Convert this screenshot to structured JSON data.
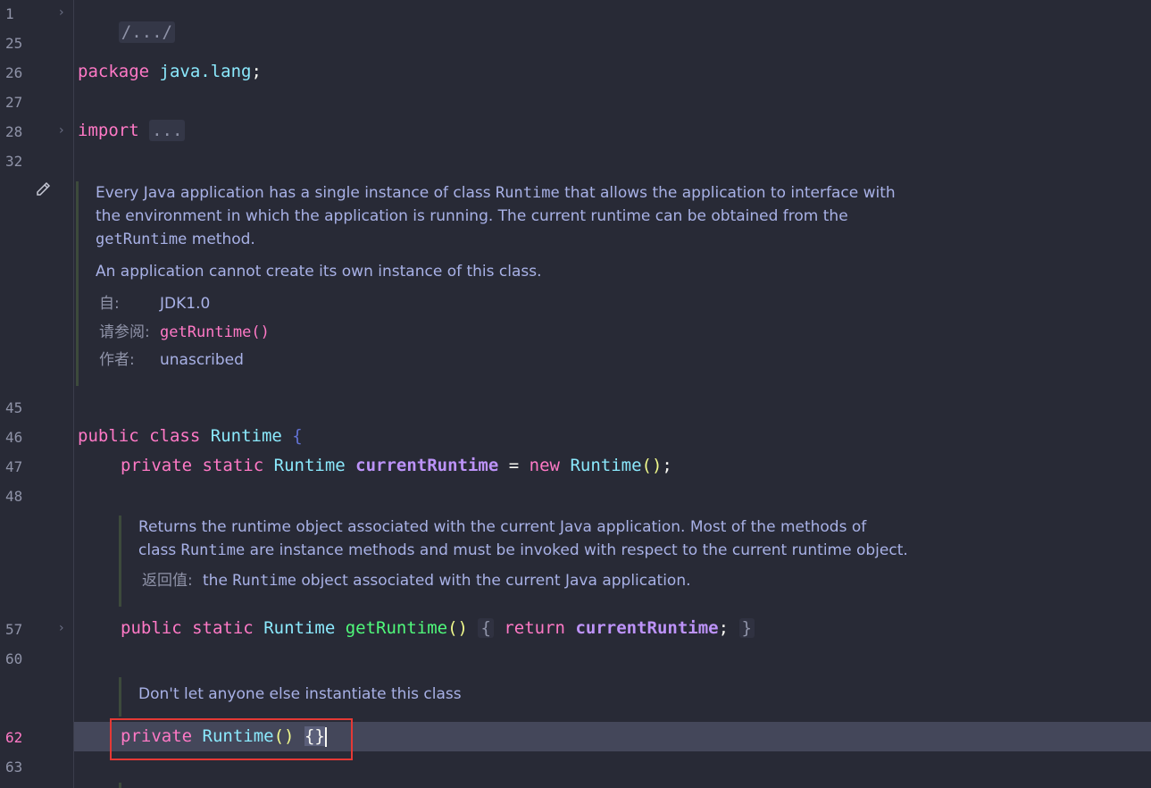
{
  "gutter": {
    "lines": [
      "1",
      "25",
      "26",
      "27",
      "28",
      "32",
      "45",
      "46",
      "47",
      "48",
      "57",
      "60",
      "62",
      "63"
    ],
    "active_line": "62"
  },
  "code": {
    "line1_placeholder": "/.../",
    "package_kw": "package",
    "package_name": "java.lang",
    "semicolon": ";",
    "import_kw": "import",
    "import_placeholder": "...",
    "public_kw": "public",
    "class_kw": "class",
    "class_name": "Runtime",
    "open_brace": "{",
    "private_kw": "private",
    "static_kw": "static",
    "type_runtime": "Runtime",
    "field_name": "currentRuntime",
    "equals": "=",
    "new_kw": "new",
    "parens": "()",
    "method_name": "getRuntime",
    "return_kw": "return",
    "close_brace": "}",
    "ctor_braces": "{}"
  },
  "class_doc": {
    "para1_part1": "Every Java application has a single instance of class ",
    "para1_code1": "Runtime",
    "para1_part2": " that allows the application to interface with",
    "para1_line2": "the environment in which the application is running. The current runtime can be obtained from the",
    "para1_code2": "getRuntime",
    "para1_part3": " method.",
    "para2": "An application cannot create its own instance of this class.",
    "since_label": "自:",
    "since_value": "JDK1.0",
    "see_label": "请参阅:",
    "see_value": "getRuntime()",
    "author_label": "作者:",
    "author_value": "unascribed"
  },
  "method_doc": {
    "line1": "Returns the runtime object associated with the current Java application. Most of the methods of",
    "line2_part1": "class ",
    "line2_code": "Runtime",
    "line2_part2": " are instance methods and must be invoked with respect to the current runtime object.",
    "returns_label": "返回值:",
    "returns_part1": "the ",
    "returns_code": "Runtime",
    "returns_part2": " object associated with the current Java application."
  },
  "ctor_doc": {
    "text": "Don't let anyone else instantiate this class"
  },
  "icons": {
    "fold": "chevron-right-icon",
    "edit": "pencil-icon"
  },
  "colors": {
    "background": "#282a36",
    "current_line": "#44475a",
    "highlight_box": "#e53935",
    "keyword": "#ff79c6",
    "type": "#8be9fd",
    "doc_text": "#a8b1e6"
  }
}
